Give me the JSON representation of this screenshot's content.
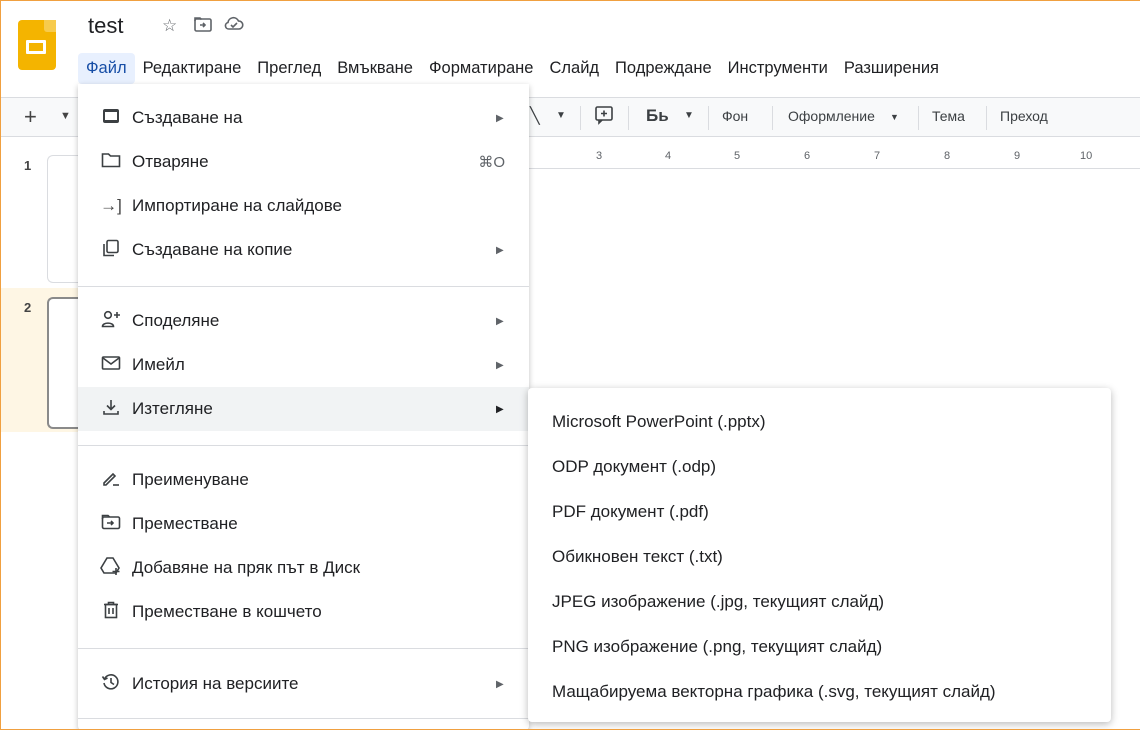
{
  "doc": {
    "title": "test"
  },
  "title_icons": [
    "star-icon",
    "move-to-folder-icon",
    "cloud-saved-icon"
  ],
  "menubar": [
    "Файл",
    "Редактиране",
    "Преглед",
    "Вмъкване",
    "Форматиране",
    "Слайд",
    "Подреждане",
    "Инструменти",
    "Разширения"
  ],
  "toolbar": {
    "plus": "+",
    "background": "Фон",
    "layout": "Оформление",
    "theme": "Тема",
    "transition": "Преход"
  },
  "ruler": [
    "3",
    "4",
    "5",
    "6",
    "7",
    "8",
    "9",
    "10"
  ],
  "filmstrip": [
    "1",
    "2"
  ],
  "file_menu": {
    "items": [
      {
        "icon": "new-slides-icon",
        "label": "Създаване на",
        "submenu": true
      },
      {
        "icon": "folder-open-icon",
        "label": "Отваряне",
        "shortcut": "⌘O"
      },
      {
        "icon": "import-icon",
        "label": "Импортиране на слайдове"
      },
      {
        "icon": "copy-icon",
        "label": "Създаване на копие",
        "submenu": true
      },
      {
        "icon": "share-icon",
        "label": "Споделяне",
        "submenu": true
      },
      {
        "icon": "email-icon",
        "label": "Имейл",
        "submenu": true
      },
      {
        "icon": "download-icon",
        "label": "Изтегляне",
        "submenu": true,
        "active": true
      },
      {
        "icon": "rename-icon",
        "label": "Преименуване"
      },
      {
        "icon": "move-icon",
        "label": "Преместване"
      },
      {
        "icon": "drive-shortcut-icon",
        "label": "Добавяне на пряк път в Диск"
      },
      {
        "icon": "trash-icon",
        "label": "Преместване в кошчето"
      },
      {
        "icon": "version-history-icon",
        "label": "История на версиите",
        "submenu": true
      }
    ]
  },
  "download_submenu": [
    "Microsoft PowerPoint (.pptx)",
    "ODP документ (.odp)",
    "PDF документ (.pdf)",
    "Обикновен текст (.txt)",
    "JPEG изображение (.jpg, текущият слайд)",
    "PNG изображение (.png, текущият слайд)",
    "Мащабируема векторна графика (.svg, текущият слайд)"
  ],
  "colors": {
    "accent": "#174ea6",
    "menu_active_bg": "#e8f0fe",
    "hover_bg": "#f1f3f4",
    "logo": "#f4b400"
  }
}
